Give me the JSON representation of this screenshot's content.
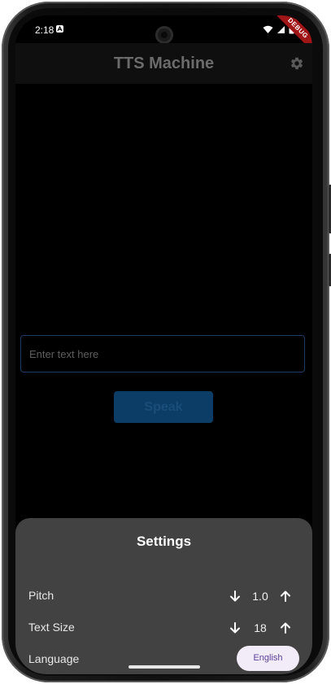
{
  "status": {
    "time": "2:18"
  },
  "debug_banner": "DEBUG",
  "appbar": {
    "title": "TTS Machine",
    "settings_icon": "gear-icon"
  },
  "input": {
    "placeholder": "Enter text here",
    "value": ""
  },
  "speak_button": {
    "label": "Speak"
  },
  "settings": {
    "title": "Settings",
    "pitch": {
      "label": "Pitch",
      "value": "1.0"
    },
    "text_size": {
      "label": "Text Size",
      "value": "18"
    },
    "language": {
      "label": "Language",
      "value": "English"
    }
  },
  "colors": {
    "accent": "#0c3d66",
    "sheet": "#424242",
    "pill_text": "#5b3f9a"
  }
}
